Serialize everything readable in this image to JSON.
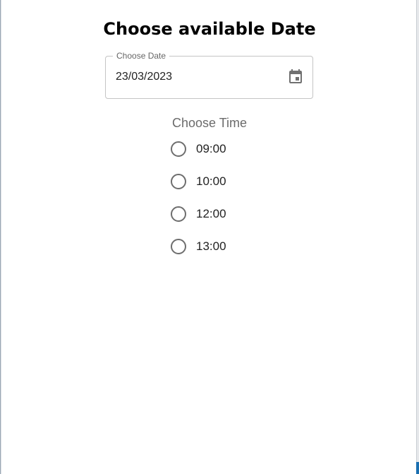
{
  "dialog": {
    "title": "Choose available Date"
  },
  "date_field": {
    "label": "Choose Date",
    "value": "23/03/2023",
    "icon": "calendar-icon"
  },
  "time_group": {
    "label": "Choose Time",
    "selected": null,
    "options": [
      {
        "label": "09:00"
      },
      {
        "label": "10:00"
      },
      {
        "label": "12:00"
      },
      {
        "label": "13:00"
      }
    ]
  },
  "colors": {
    "text": "#000000",
    "muted": "#6b6b6b",
    "border": "#c4c4c4",
    "radio": "#6e6e6e"
  }
}
